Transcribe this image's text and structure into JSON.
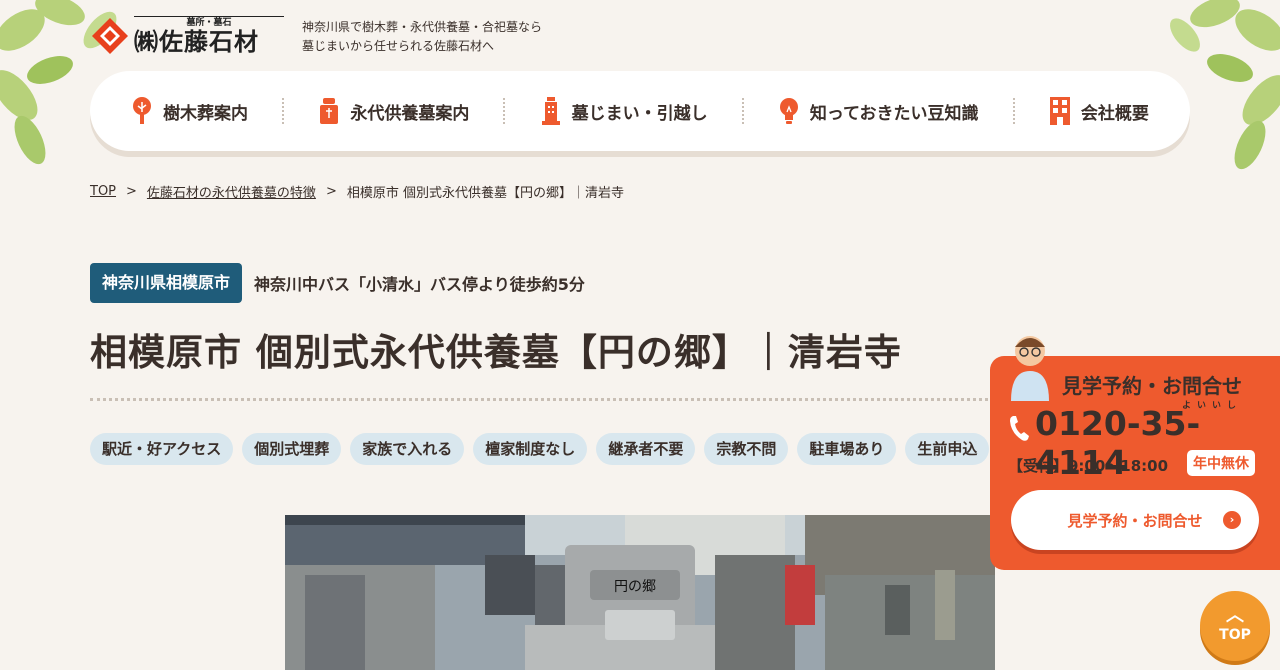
{
  "header": {
    "logo_sub": "墓所・墓石",
    "logo_main": "㈱佐藤石材",
    "tagline_1": "神奈川県で樹木葬・永代供養墓・合祀墓なら",
    "tagline_2": "墓じまいから任せられる佐藤石材へ"
  },
  "nav": {
    "items": [
      {
        "label": "樹木葬案内",
        "icon": "tree-icon"
      },
      {
        "label": "永代供養墓案内",
        "icon": "tombstone-icon"
      },
      {
        "label": "墓じまい・引越し",
        "icon": "building-icon"
      },
      {
        "label": "知っておきたい豆知識",
        "icon": "lightbulb-icon"
      },
      {
        "label": "会社概要",
        "icon": "office-icon"
      }
    ]
  },
  "breadcrumb": {
    "home": "TOP",
    "sep": ">",
    "parent": "佐藤石材の永代供養墓の特徴",
    "current": "相模原市 個別式永代供養墓【円の郷】｜清岩寺"
  },
  "location": {
    "badge": "神奈川県相模原市",
    "access": "神奈川中バス「小清水」バス停より徒歩約5分"
  },
  "title": "相模原市 個別式永代供養墓【円の郷】｜清岩寺",
  "tags": [
    "駅近・好アクセス",
    "個別式埋葬",
    "家族で入れる",
    "檀家制度なし",
    "継承者不要",
    "宗教不問",
    "駐車場あり",
    "生前申込"
  ],
  "photo": {
    "engraving": "円の郷"
  },
  "contact": {
    "title": "見学予約・お問合せ",
    "ruby": "よいいし",
    "phone": "0120-35-4114",
    "hours": "【受付】9:00〜18:00",
    "badge": "年中無休",
    "button": "見学予約・お問合せ"
  },
  "top_button": "TOP",
  "colors": {
    "accent": "#ee5a2e",
    "badge_blue": "#1f5c7a",
    "tag_bg": "#d9e7ee",
    "top_orange": "#f29a2e",
    "background": "#f7f3ee"
  }
}
